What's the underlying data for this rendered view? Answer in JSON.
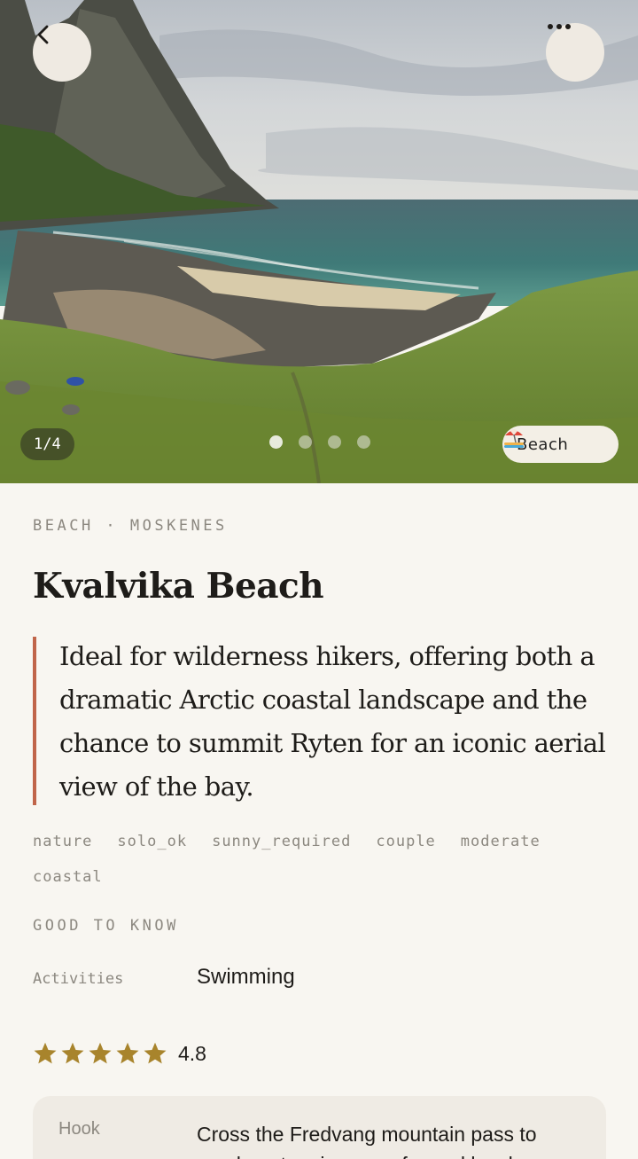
{
  "hero": {
    "counter": "1/4",
    "dots": 4,
    "active_dot": 0,
    "type_chip": {
      "label": "Beach",
      "icon": "beach-umbrella-icon"
    }
  },
  "header": {
    "back_icon": "chevron-left-icon",
    "more_icon": "more-horizontal-icon"
  },
  "place": {
    "eyebrow": "BEACH · MOSKENES",
    "title": "Kvalvika Beach",
    "quote": "Ideal for wilderness hikers, offering both a dramatic Arctic coastal landscape and the chance to summit Ryten for an iconic aerial view of the bay.",
    "tags": [
      "nature",
      "solo_ok",
      "sunny_required",
      "couple",
      "moderate",
      "coastal"
    ]
  },
  "good_to_know": {
    "label": "GOOD TO KNOW",
    "rows": [
      {
        "key": "Activities",
        "value": "Swimming"
      }
    ]
  },
  "rating": {
    "stars": 5,
    "value": "4.8"
  },
  "hook": {
    "key": "Hook",
    "value": "Cross the Fredvang mountain pass to reach a stunning cove framed by sh"
  },
  "colors": {
    "background": "#f8f6f1",
    "accent": "#c0654a",
    "star": "#a8842c",
    "muted": "#8c8880"
  }
}
